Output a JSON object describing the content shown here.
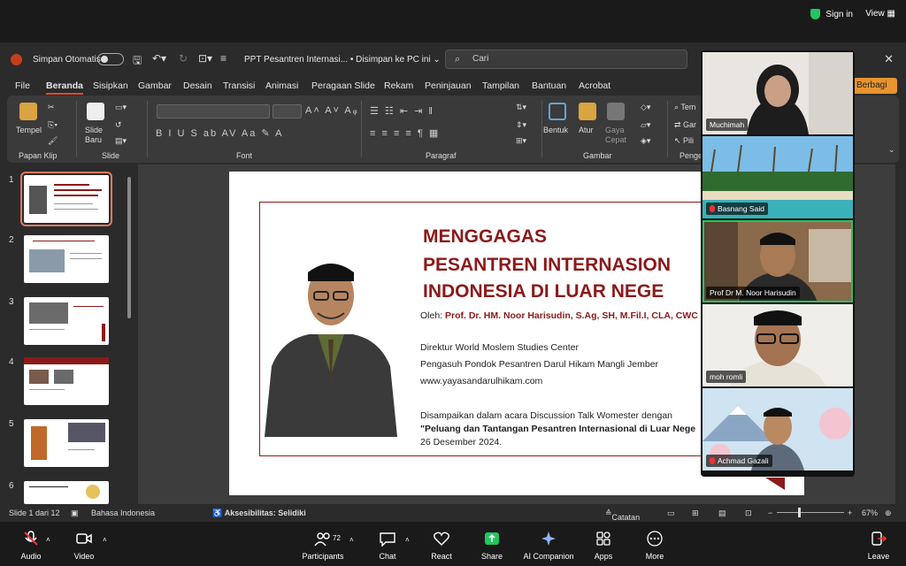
{
  "zoom_top": {
    "signin": "Sign in",
    "view": "View"
  },
  "ppt": {
    "autosave_label": "Simpan Otomatis",
    "doc_title": "PPT Pesantren Internasi...",
    "save_status": "Disimpan ke PC ini",
    "search_placeholder": "Cari",
    "menu": [
      "File",
      "Beranda",
      "Sisipkan",
      "Gambar",
      "Desain",
      "Transisi",
      "Animasi",
      "Peragaan Slide",
      "Rekam",
      "Peninjauan",
      "Tampilan",
      "Bantuan",
      "Acrobat"
    ],
    "share_button": "Berbagi",
    "ribbon": {
      "paste": "Tempel",
      "new_slide": "Slide Baru",
      "shape": "Bentuk",
      "arrange": "Atur",
      "quick_style": "Gaya Cepat",
      "groups": [
        "Papan Klip",
        "Slide",
        "Font",
        "Paragraf",
        "Gambar",
        "Penge"
      ],
      "partial_right": [
        "Tem",
        "Gar",
        "Pili"
      ]
    },
    "slide_numbers": [
      "1",
      "2",
      "3",
      "4",
      "5",
      "6"
    ],
    "thumb_titles": [
      "MENGGAGAS PESANTREN INTERNASIONAL INDONESIA DI LUAR NEGERI",
      "Pesantren Internasional Indonesia, Mengapa?",
      "",
      "Mengapa Pesantren Internasional Indonesia?",
      "Apa Tujuannya?",
      "Umur (Minimal) Pesantren Internasional"
    ],
    "slide": {
      "title_line1": "MENGGAGAS",
      "title_line2": "PESANTREN INTERNASION",
      "title_line3": "INDONESIA DI LUAR NEGE",
      "by_prefix": "Oleh: ",
      "by_name": "Prof. Dr. HM. Noor Harisudin, S.Ag, SH, M.Fil.I, CLA, CWC",
      "line_director": "Direktur World Moslem Studies Center",
      "line_caretaker": "Pengasuh Pondok Pesantren Darul Hikam Mangli Jember",
      "line_web": "www.yayasandarulhikam.com",
      "line_event": "Disampaikan dalam acara Discussion Talk Womester dengan",
      "line_topic": "\"Peluang dan Tantangan Pesantren Internasional di Luar Nege",
      "line_date": "26 Desember 2024."
    },
    "status": {
      "slide_count": "Slide 1 dari 12",
      "language": "Bahasa Indonesia",
      "accessibility": "Aksesibilitas: Selidiki",
      "notes": "Catatan",
      "zoom": "67%"
    }
  },
  "participants_video": [
    {
      "name": "Muchimah",
      "muted": false
    },
    {
      "name": "Basnang Said",
      "muted": true
    },
    {
      "name": "Prof Dr M. Noor Harisudin",
      "muted": true
    },
    {
      "name": "moh romli",
      "muted": false
    },
    {
      "name": "Achmad Gazali",
      "muted": true
    }
  ],
  "zoom_bar": {
    "audio": "Audio",
    "video": "Video",
    "participants": "Participants",
    "participant_count": "72",
    "chat": "Chat",
    "react": "React",
    "share": "Share",
    "ai": "AI Companion",
    "apps": "Apps",
    "more": "More",
    "leave": "Leave"
  },
  "colors": {
    "accent_red": "#8b1a1a",
    "speaking_border": "#22c55e",
    "share_green": "#22c55e",
    "leave_red": "#e33"
  }
}
